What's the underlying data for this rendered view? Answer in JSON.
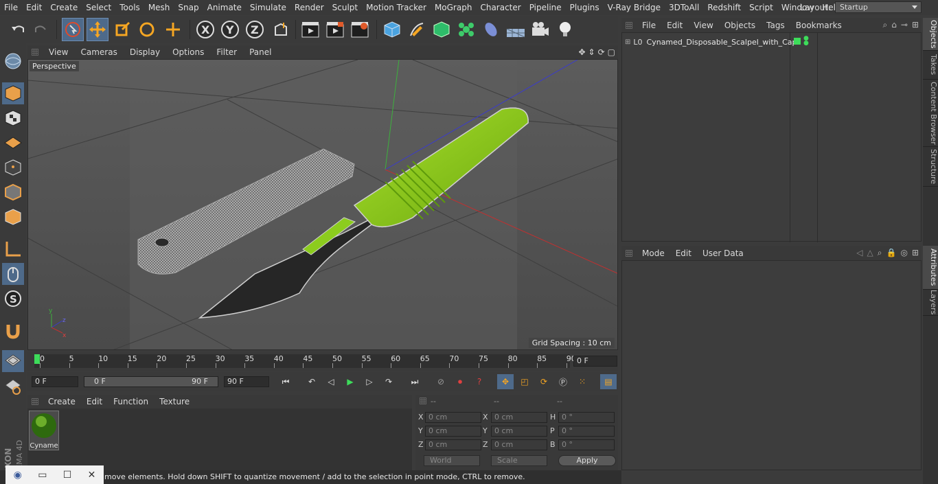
{
  "menubar": {
    "items": [
      "File",
      "Edit",
      "Create",
      "Select",
      "Tools",
      "Mesh",
      "Snap",
      "Animate",
      "Simulate",
      "Render",
      "Sculpt",
      "Motion Tracker",
      "MoGraph",
      "Character",
      "Pipeline",
      "Plugins",
      "V-Ray Bridge",
      "3DToAll",
      "Redshift",
      "Script",
      "Window",
      "Help"
    ],
    "layout_label": "Layout:",
    "layout_value": "Startup"
  },
  "toolbar": {
    "icons": [
      "undo-icon",
      "redo-icon",
      "select-arrow-icon",
      "move-icon",
      "scale-icon",
      "rotate-icon",
      "live-select-icon",
      "x-axis-icon",
      "y-axis-icon",
      "z-axis-icon",
      "coordinate-system-icon",
      "render-view-icon",
      "render-picture-viewer-icon",
      "edit-render-settings-icon",
      "cube-icon",
      "pen-icon",
      "subdivision-icon",
      "cloner-icon",
      "deformer-icon",
      "scene-icon",
      "camera-icon",
      "light-icon"
    ]
  },
  "viewport": {
    "menu": [
      "View",
      "Cameras",
      "Display",
      "Options",
      "Filter",
      "Panel"
    ],
    "label": "Perspective",
    "grid_spacing": "Grid Spacing : 10 cm"
  },
  "timeline": {
    "ticks": [
      "0",
      "5",
      "10",
      "15",
      "20",
      "25",
      "30",
      "35",
      "40",
      "45",
      "50",
      "55",
      "60",
      "65",
      "70",
      "75",
      "80",
      "85",
      "90"
    ],
    "current": "0 F"
  },
  "anim": {
    "start": "0 F",
    "range_start": "0 F",
    "range_end": "90 F",
    "end": "90 F"
  },
  "material": {
    "menu": [
      "Create",
      "Edit",
      "Function",
      "Texture"
    ],
    "mat_name": "Cyname"
  },
  "coords": {
    "headers": [
      "--",
      "--",
      "--"
    ],
    "rows": [
      {
        "a": "X",
        "av": "0 cm",
        "b": "X",
        "bv": "0 cm",
        "c": "H",
        "cv": "0 °"
      },
      {
        "a": "Y",
        "av": "0 cm",
        "b": "Y",
        "bv": "0 cm",
        "c": "P",
        "cv": "0 °"
      },
      {
        "a": "Z",
        "av": "0 cm",
        "b": "Z",
        "bv": "0 cm",
        "c": "B",
        "cv": "0 °"
      }
    ],
    "world": "World",
    "scale": "Scale",
    "apply": "Apply"
  },
  "status": "move elements. Hold down SHIFT to quantize movement / add to the selection in point mode, CTRL to remove.",
  "objmgr": {
    "menu": [
      "File",
      "Edit",
      "View",
      "Objects",
      "Tags",
      "Bookmarks"
    ],
    "object_name": "Cynamed_Disposable_Scalpel_with_Cap"
  },
  "attr": {
    "menu": [
      "Mode",
      "Edit",
      "User Data"
    ]
  },
  "sidetabs": [
    "Objects",
    "Takes",
    "Content Browser",
    "Structure",
    "Attributes",
    "Layers"
  ],
  "brand": {
    "maxon": "MAXON",
    "c4d": "CINEMA 4D"
  },
  "colors": {
    "accent": "#4e6a8a",
    "scalpel_green": "#8ccc1e",
    "blade": "#2a2a2a"
  }
}
